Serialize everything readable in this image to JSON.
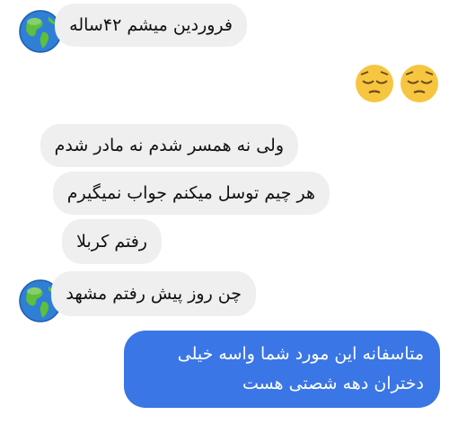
{
  "messages": [
    {
      "sender": "them",
      "text": "فروردین میشم ۴۲ساله"
    },
    {
      "sender": "them",
      "text": "😔😔"
    },
    {
      "sender": "them",
      "text": "ولی نه همسر شدم نه مادر شدم"
    },
    {
      "sender": "them",
      "text": "هر چیم توسل میکنم جواب نمیگیرم"
    },
    {
      "sender": "them",
      "text": "رفتم کربلا"
    },
    {
      "sender": "them",
      "text": "چن روز پیش رفتم مشهد"
    },
    {
      "sender": "me",
      "text": "متاسفانه این مورد شما واسه خیلی دختران دهه شصتی هست"
    }
  ],
  "avatar_icon": "globe-americas-icon",
  "emoji_icon": "pensive-face-icon",
  "colors": {
    "incoming_bubble": "#efefef",
    "outgoing_bubble": "#3a76e5",
    "background": "#ffffff"
  }
}
